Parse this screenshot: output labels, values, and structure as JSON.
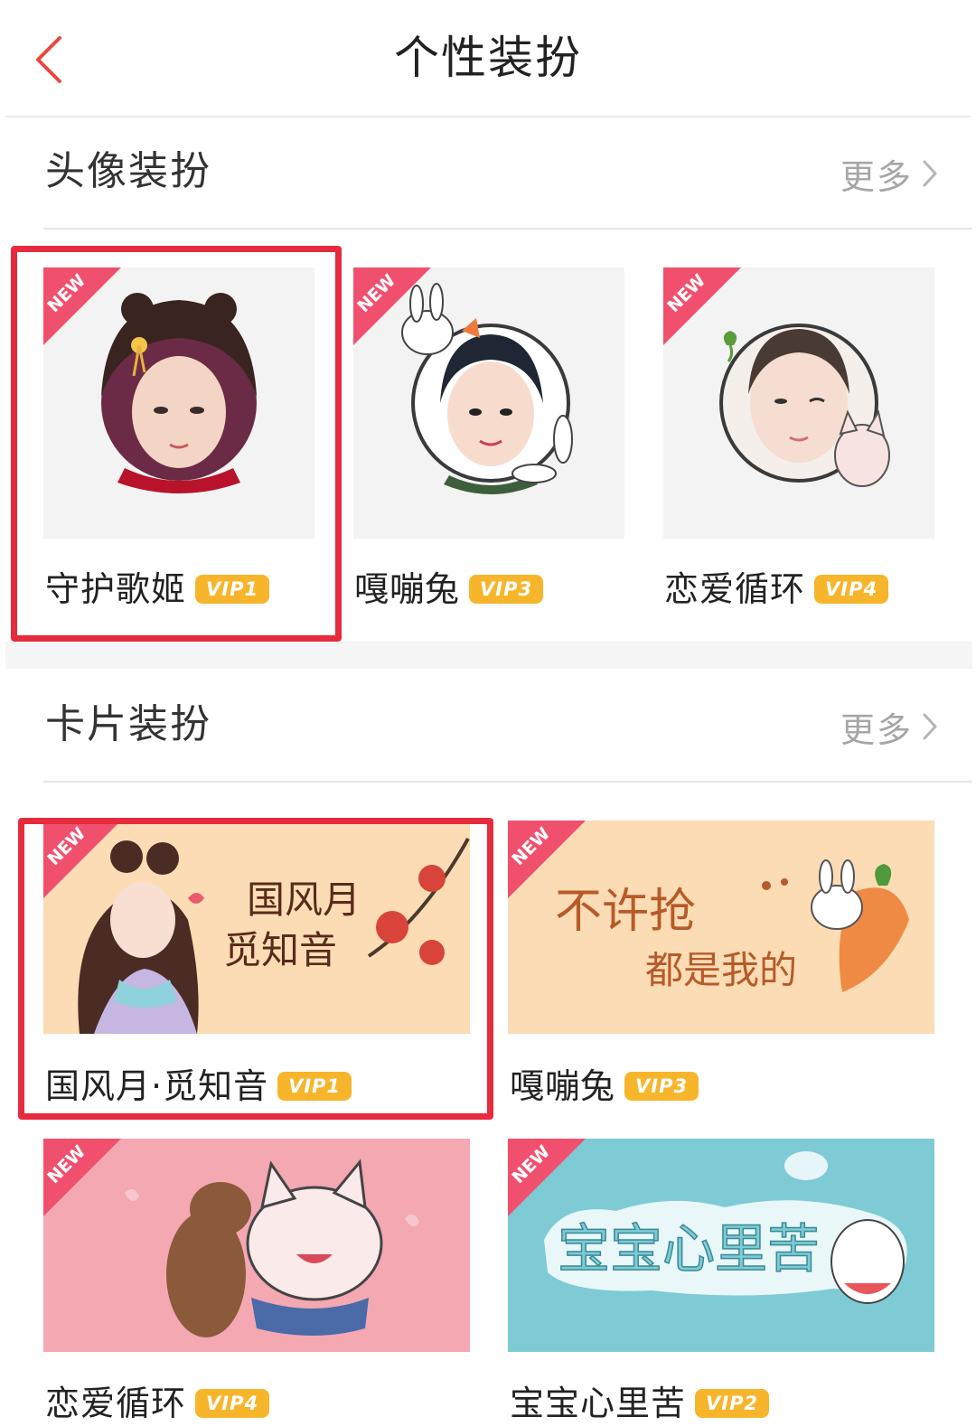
{
  "header": {
    "title": "个性装扮",
    "back_icon": "chevron-left-icon",
    "accent_color": "#e8473d"
  },
  "avatar_section": {
    "title": "头像装扮",
    "more_label": "更多",
    "items": [
      {
        "name": "守护歌姬",
        "vip": "VIP1",
        "badge": "NEW",
        "highlighted": true
      },
      {
        "name": "嘎嘣兔",
        "vip": "VIP3",
        "badge": "NEW",
        "highlighted": false
      },
      {
        "name": "恋爱循环",
        "vip": "VIP4",
        "badge": "NEW",
        "highlighted": false
      }
    ]
  },
  "card_section": {
    "title": "卡片装扮",
    "more_label": "更多",
    "items": [
      {
        "name": "国风月·觅知音",
        "vip": "VIP1",
        "badge": "NEW",
        "highlighted": true,
        "art_text": [
          "国风月",
          "觅知音"
        ]
      },
      {
        "name": "嘎嘣兔",
        "vip": "VIP3",
        "badge": "NEW",
        "highlighted": false,
        "art_text": [
          "不许抢",
          "都是我的"
        ]
      },
      {
        "name": "恋爱循环",
        "vip": "VIP4",
        "badge": "NEW",
        "highlighted": false
      },
      {
        "name": "宝宝心里苦",
        "vip": "VIP2",
        "badge": "NEW",
        "highlighted": false,
        "art_text": [
          "宝宝心里苦"
        ]
      }
    ]
  },
  "colors": {
    "new_ribbon": "#f0506e",
    "vip_badge": "#f7b52c",
    "highlight_border": "#e62b3c",
    "more_text": "#a6a6a6"
  }
}
